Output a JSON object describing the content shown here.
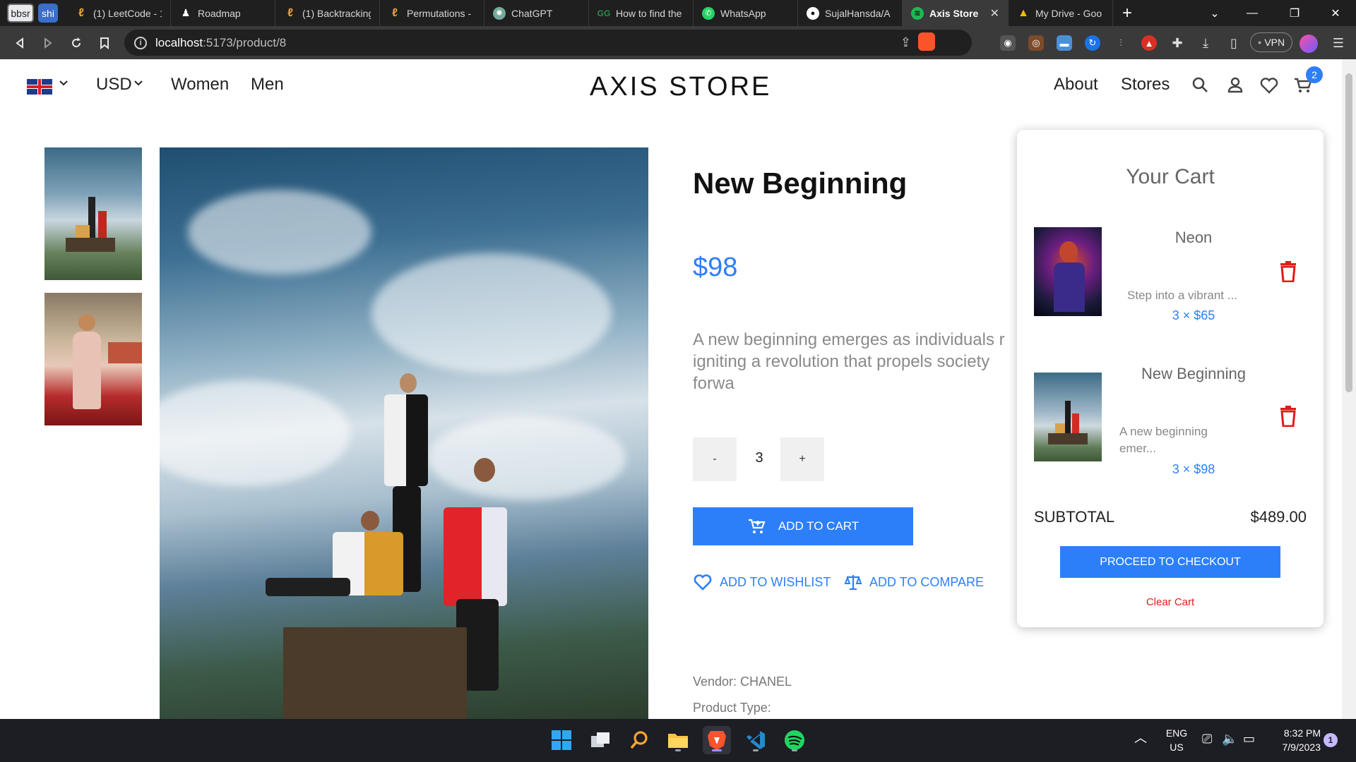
{
  "browser": {
    "pinned_tabs": [
      "bbsr",
      "shi"
    ],
    "tabs": [
      {
        "label": "(1) LeetCode - 1",
        "icon": "leetcode-icon",
        "color": "#f0a33a"
      },
      {
        "label": "Roadmap",
        "icon": "roadmap-icon",
        "color": "#ffffff"
      },
      {
        "label": "(1) Backtracking",
        "icon": "leetcode-icon",
        "color": "#f0a33a"
      },
      {
        "label": "Permutations -",
        "icon": "leetcode-icon",
        "color": "#f0a33a"
      },
      {
        "label": "ChatGPT",
        "icon": "chatgpt-icon",
        "color": "#74aa9c"
      },
      {
        "label": "How to find the",
        "icon": "gfg-icon",
        "color": "#2f8d46"
      },
      {
        "label": "WhatsApp",
        "icon": "whatsapp-icon",
        "color": "#25d366"
      },
      {
        "label": "SujalHansda/A",
        "icon": "github-icon",
        "color": "#ffffff"
      },
      {
        "label": "Axis Store",
        "icon": "spotify-icon",
        "color": "#1db954"
      },
      {
        "label": "My Drive - Goo",
        "icon": "drive-icon",
        "color": "#fbbc04"
      }
    ],
    "active_tab_index": 8,
    "url": {
      "host": "localhost",
      "path": ":5173/product/8"
    },
    "vpn_label": "VPN"
  },
  "header": {
    "currency": "USD",
    "nav_left": [
      "Women",
      "Men"
    ],
    "brand": "AXIS STORE",
    "nav_right": [
      "About",
      "Stores"
    ],
    "cart_count": "2"
  },
  "product": {
    "title": "New Beginning",
    "price": "$98",
    "description": "A new beginning emerges as individuals r\nigniting a revolution that propels society forwa\nchange, and infinite possibilities.",
    "quantity": "3",
    "minus_label": "-",
    "plus_label": "+",
    "add_to_cart": "ADD TO CART",
    "add_to_wishlist": "ADD TO WISHLIST",
    "add_to_compare": "ADD TO COMPARE",
    "vendor": "Vendor: CHANEL",
    "product_type": "Product Type:"
  },
  "cart": {
    "title": "Your Cart",
    "items": [
      {
        "name": "Neon",
        "desc": "Step into a vibrant ...",
        "qty_price": "3 × $65"
      },
      {
        "name": "New Beginning",
        "desc": "A new beginning\nemer...",
        "qty_price": "3 × $98"
      }
    ],
    "subtotal_label": "SUBTOTAL",
    "subtotal_value": "$489.00",
    "checkout_label": "PROCEED TO CHECKOUT",
    "clear_label": "Clear Cart"
  },
  "taskbar": {
    "lang_line1": "ENG",
    "lang_line2": "US",
    "time": "8:32 PM",
    "date": "7/9/2023",
    "notifications": "1"
  }
}
